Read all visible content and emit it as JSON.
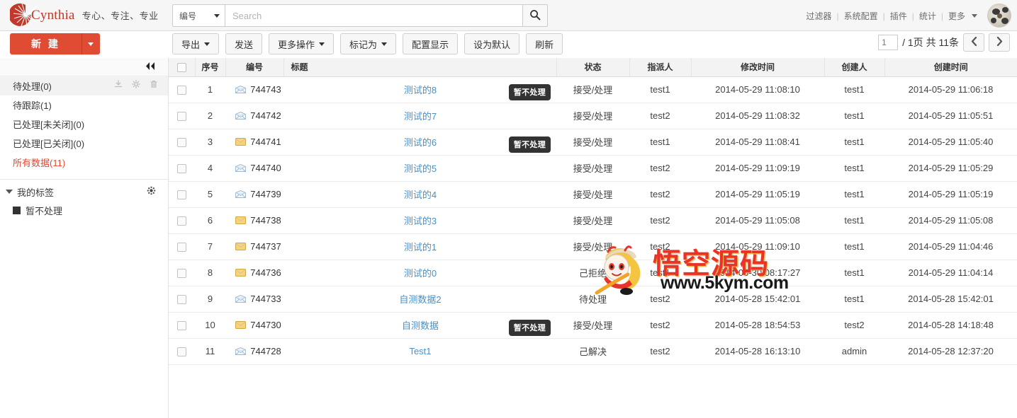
{
  "app": {
    "brand": "Cynthia",
    "slogan": "专心、专注、专业"
  },
  "search": {
    "field_label": "编号",
    "placeholder": "Search",
    "value": "",
    "button_icon": "search-icon"
  },
  "topnav": {
    "items": [
      {
        "label": "过滤器"
      },
      {
        "label": "系统配置"
      },
      {
        "label": "插件"
      },
      {
        "label": "统计"
      },
      {
        "label": "更多"
      }
    ],
    "separator": "|",
    "avatar_icon": "user-avatar"
  },
  "actions": {
    "new_label": "新 建",
    "new_caret": "caret-down-icon"
  },
  "toolbar": {
    "buttons": [
      {
        "label": "导出",
        "caret": true
      },
      {
        "label": "发送",
        "caret": false
      },
      {
        "label": "更多操作",
        "caret": true
      },
      {
        "label": "标记为",
        "caret": true
      },
      {
        "label": "配置显示",
        "caret": false
      },
      {
        "label": "设为默认",
        "caret": false
      },
      {
        "label": "刷新",
        "caret": false
      }
    ]
  },
  "pager": {
    "page_value": "1",
    "summary": "/ 1页 共 11条",
    "prev_icon": "chevron-left-icon",
    "next_icon": "chevron-right-icon"
  },
  "sidebar": {
    "collapse_icon": "double-chevron-left-icon",
    "folders": [
      {
        "label": "待处理(0)",
        "active": true,
        "selected": false,
        "actions": [
          "download-icon",
          "gear-icon",
          "trash-icon"
        ]
      },
      {
        "label": "待跟踪(1)",
        "active": false,
        "selected": false
      },
      {
        "label": "已处理[未关闭](0)",
        "active": false,
        "selected": false
      },
      {
        "label": "已处理[已关闭](0)",
        "active": false,
        "selected": false
      },
      {
        "label": "所有数据(11)",
        "active": false,
        "selected": true
      }
    ],
    "tags_header": "我的标签",
    "tags_gear_icon": "gear-icon",
    "tags": [
      {
        "label": "暂不处理",
        "color": "#333333"
      }
    ]
  },
  "table": {
    "columns": [
      {
        "key": "checkbox",
        "label": ""
      },
      {
        "key": "seq",
        "label": "序号"
      },
      {
        "key": "num",
        "label": "编号"
      },
      {
        "key": "title",
        "label": "标题"
      },
      {
        "key": "status",
        "label": "状态"
      },
      {
        "key": "assignee",
        "label": "指派人"
      },
      {
        "key": "modified",
        "label": "修改时间"
      },
      {
        "key": "creator",
        "label": "创建人"
      },
      {
        "key": "created",
        "label": "创建时间"
      }
    ],
    "rows": [
      {
        "seq": "1",
        "num": "744743",
        "envelope": "open",
        "title": "测试的8",
        "badge": "暂不处理",
        "status": "接受/处理",
        "assignee": "test1",
        "modified": "2014-05-29 11:08:10",
        "creator": "test1",
        "created": "2014-05-29 11:06:18"
      },
      {
        "seq": "2",
        "num": "744742",
        "envelope": "open",
        "title": "测试的7",
        "badge": "",
        "status": "接受/处理",
        "assignee": "test2",
        "modified": "2014-05-29 11:08:32",
        "creator": "test1",
        "created": "2014-05-29 11:05:51"
      },
      {
        "seq": "3",
        "num": "744741",
        "envelope": "closed",
        "title": "测试的6",
        "badge": "暂不处理",
        "status": "接受/处理",
        "assignee": "test1",
        "modified": "2014-05-29 11:08:41",
        "creator": "test1",
        "created": "2014-05-29 11:05:40"
      },
      {
        "seq": "4",
        "num": "744740",
        "envelope": "open",
        "title": "测试的5",
        "badge": "",
        "status": "接受/处理",
        "assignee": "test2",
        "modified": "2014-05-29 11:09:19",
        "creator": "test1",
        "created": "2014-05-29 11:05:29"
      },
      {
        "seq": "5",
        "num": "744739",
        "envelope": "open",
        "title": "测试的4",
        "badge": "",
        "status": "接受/处理",
        "assignee": "test2",
        "modified": "2014-05-29 11:05:19",
        "creator": "test1",
        "created": "2014-05-29 11:05:19"
      },
      {
        "seq": "6",
        "num": "744738",
        "envelope": "closed",
        "title": "测试的3",
        "badge": "",
        "status": "接受/处理",
        "assignee": "test2",
        "modified": "2014-05-29 11:05:08",
        "creator": "test1",
        "created": "2014-05-29 11:05:08"
      },
      {
        "seq": "7",
        "num": "744737",
        "envelope": "closed",
        "title": "测试的1",
        "badge": "",
        "status": "接受/处理",
        "assignee": "test2",
        "modified": "2014-05-29 11:09:10",
        "creator": "test1",
        "created": "2014-05-29 11:04:46"
      },
      {
        "seq": "8",
        "num": "744736",
        "envelope": "closed",
        "title": "测试的0",
        "badge": "",
        "status": "己拒绝",
        "assignee": "test1",
        "modified": "2014-05-30 08:17:27",
        "creator": "test1",
        "created": "2014-05-29 11:04:14"
      },
      {
        "seq": "9",
        "num": "744733",
        "envelope": "open",
        "title": "自测数据2",
        "badge": "",
        "status": "待处理",
        "assignee": "test2",
        "modified": "2014-05-28 15:42:01",
        "creator": "test1",
        "created": "2014-05-28 15:42:01"
      },
      {
        "seq": "10",
        "num": "744730",
        "envelope": "closed",
        "title": "自测数据",
        "badge": "暂不处理",
        "status": "接受/处理",
        "assignee": "test2",
        "modified": "2014-05-28 18:54:53",
        "creator": "test2",
        "created": "2014-05-28 14:18:48"
      },
      {
        "seq": "11",
        "num": "744728",
        "envelope": "open",
        "title": "Test1",
        "badge": "",
        "status": "己解决",
        "assignee": "test2",
        "modified": "2014-05-28 16:13:10",
        "creator": "admin",
        "created": "2014-05-28 12:37:20"
      }
    ]
  },
  "watermark": {
    "text": "悟空源码",
    "url": "www.5kym.com"
  },
  "colors": {
    "brand_red": "#e04b34",
    "link_blue": "#4a90c4",
    "selected_red": "#e04b34",
    "badge_dark": "#333333",
    "watermark_red": "#e8332a"
  }
}
